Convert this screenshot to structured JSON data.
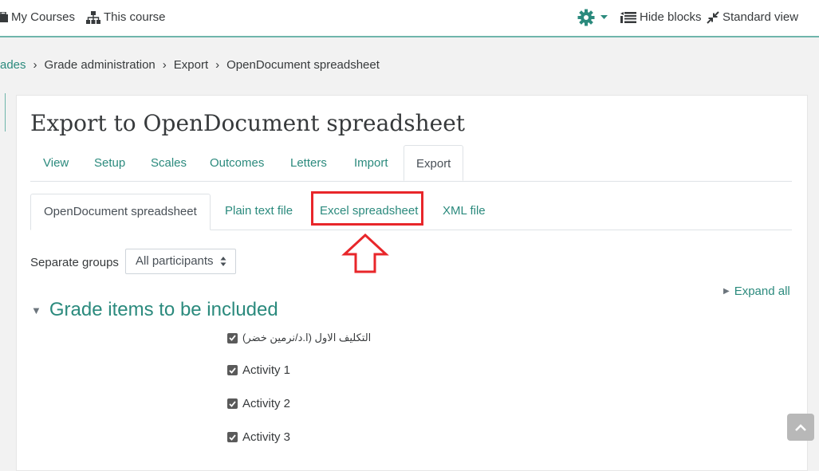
{
  "navbar": {
    "my_courses": "My Courses",
    "this_course": "This course",
    "hide_blocks": "Hide blocks",
    "standard_view": "Standard view"
  },
  "breadcrumb": {
    "items": [
      "ades",
      "Grade administration",
      "Export",
      "OpenDocument spreadsheet"
    ],
    "separator": "›"
  },
  "page": {
    "title": "Export to OpenDocument spreadsheet"
  },
  "primary_tabs": [
    "View",
    "Setup",
    "Scales",
    "Outcomes",
    "Letters",
    "Import",
    "Export"
  ],
  "secondary_tabs": [
    "OpenDocument spreadsheet",
    "Plain text file",
    "Excel spreadsheet",
    "XML file"
  ],
  "groups": {
    "label": "Separate groups",
    "selected": "All participants"
  },
  "expand_all": "Expand all",
  "section": {
    "title": "Grade items to be included",
    "items": [
      {
        "label": "التكليف الاول (ا.د/نرمين خضر)",
        "checked": true
      },
      {
        "label": "Activity 1",
        "checked": true
      },
      {
        "label": "Activity 2",
        "checked": true
      },
      {
        "label": "Activity 3",
        "checked": true
      }
    ]
  },
  "colors": {
    "accent": "#2b8a7d",
    "gear": "#2b8a7d",
    "highlight": "#e8262a"
  }
}
